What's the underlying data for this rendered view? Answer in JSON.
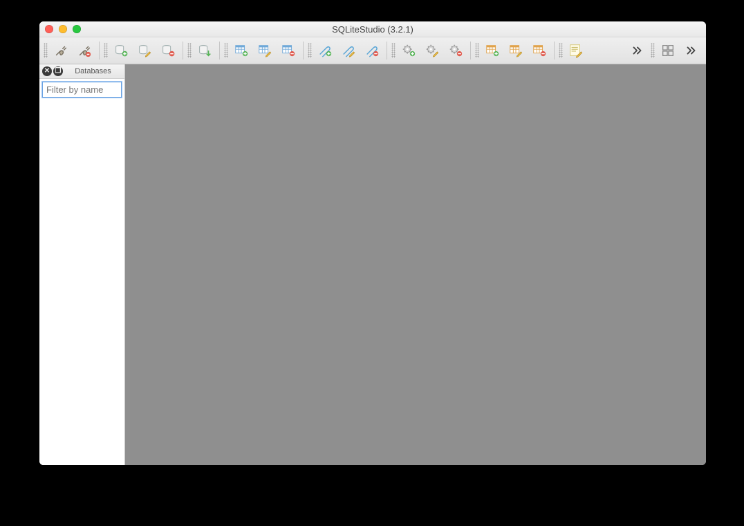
{
  "window": {
    "title": "SQLiteStudio (3.2.1)"
  },
  "sidebar": {
    "panel_title": "Databases",
    "filter_placeholder": "Filter by name"
  },
  "toolbar": {
    "buttons": {
      "connect": "Connect to database",
      "disconnect": "Disconnect from database",
      "db_add": "Add database",
      "db_edit": "Edit database",
      "db_remove": "Remove database",
      "db_import": "Import database",
      "table_add": "Create table",
      "table_edit": "Edit table",
      "table_remove": "Drop table",
      "index_add": "Create index",
      "index_edit": "Edit index",
      "index_remove": "Drop index",
      "trigger_add": "Create trigger",
      "trigger_edit": "Edit trigger",
      "trigger_remove": "Drop trigger",
      "view_add": "Create view",
      "view_edit": "Edit view",
      "view_remove": "Drop view",
      "sql_editor": "Open SQL editor",
      "overflow1": "More tools",
      "window_tile": "Tile windows",
      "overflow2": "More windows"
    }
  }
}
